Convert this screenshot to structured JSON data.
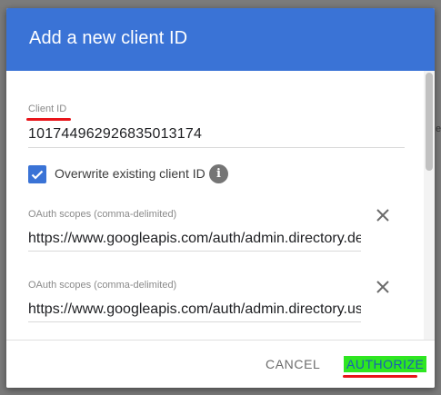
{
  "dialog": {
    "title": "Add a new client ID"
  },
  "client_id": {
    "label": "Client ID",
    "value": "101744962926835013174"
  },
  "overwrite": {
    "label": "Overwrite existing client ID",
    "checked": true
  },
  "scopes": [
    {
      "label": "OAuth scopes (comma-delimited)",
      "value": "https://www.googleapis.com/auth/admin.directory.device.chromeos"
    },
    {
      "label": "OAuth scopes (comma-delimited)",
      "value": "https://www.googleapis.com/auth/admin.directory.user"
    }
  ],
  "footer": {
    "cancel_label": "CANCEL",
    "authorize_label": "AUTHORIZE"
  },
  "icons": {
    "info": "info-icon",
    "remove": "close-icon",
    "checkbox": "check-icon"
  },
  "colors": {
    "header_blue": "#3a73d6",
    "highlight_green": "#2ee621",
    "annotation_red": "#e8141a",
    "authorize_text": "#1a5fb4"
  }
}
